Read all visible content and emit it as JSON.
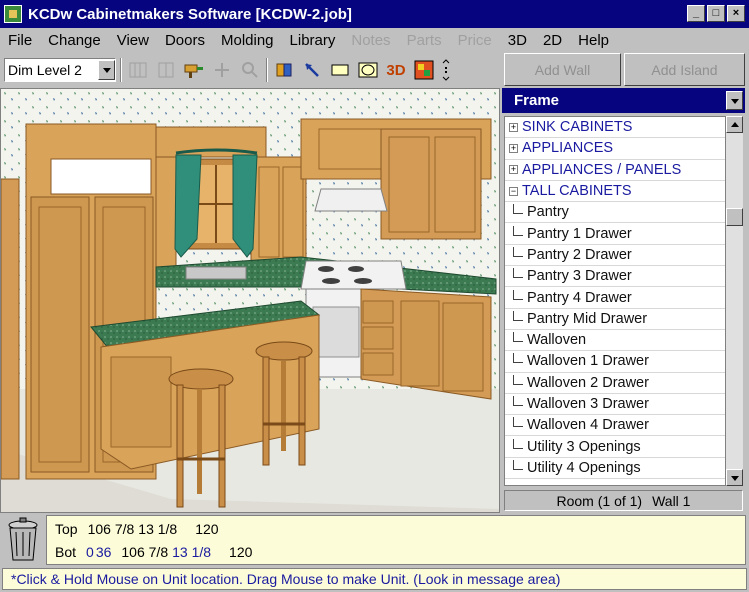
{
  "window": {
    "title": "KCDw Cabinetmakers Software [KCDW-2.job]",
    "buttons": [
      "_",
      "□",
      "×"
    ]
  },
  "menu": [
    {
      "label": "File",
      "enabled": true
    },
    {
      "label": "Change",
      "enabled": true
    },
    {
      "label": "View",
      "enabled": true
    },
    {
      "label": "Doors",
      "enabled": true
    },
    {
      "label": "Molding",
      "enabled": true
    },
    {
      "label": "Library",
      "enabled": true
    },
    {
      "label": "Notes",
      "enabled": false
    },
    {
      "label": "Parts",
      "enabled": false
    },
    {
      "label": "Price",
      "enabled": false
    },
    {
      "label": "3D",
      "enabled": true
    },
    {
      "label": "2D",
      "enabled": true
    },
    {
      "label": "Help",
      "enabled": true
    }
  ],
  "toolbar": {
    "dim_level": "Dim Level 2",
    "view3d_label": "3D",
    "add_wall": "Add Wall",
    "add_island": "Add Island"
  },
  "panel": {
    "header": "Frame",
    "items": [
      {
        "label": "SINK CABINETS",
        "kind": "cat",
        "exp": "+"
      },
      {
        "label": "APPLIANCES",
        "kind": "cat",
        "exp": "+"
      },
      {
        "label": "APPLIANCES / PANELS",
        "kind": "cat",
        "exp": "+"
      },
      {
        "label": "TALL CABINETS",
        "kind": "cat",
        "exp": "−"
      },
      {
        "label": "Pantry",
        "kind": "sub"
      },
      {
        "label": "Pantry 1 Drawer",
        "kind": "sub"
      },
      {
        "label": "Pantry 2 Drawer",
        "kind": "sub"
      },
      {
        "label": "Pantry 3 Drawer",
        "kind": "sub"
      },
      {
        "label": "Pantry 4 Drawer",
        "kind": "sub"
      },
      {
        "label": "Pantry Mid Drawer",
        "kind": "sub"
      },
      {
        "label": "Walloven",
        "kind": "sub"
      },
      {
        "label": "Walloven 1 Drawer",
        "kind": "sub"
      },
      {
        "label": "Walloven 2 Drawer",
        "kind": "sub"
      },
      {
        "label": "Walloven 3 Drawer",
        "kind": "sub"
      },
      {
        "label": "Walloven 4 Drawer",
        "kind": "sub"
      },
      {
        "label": "Utility 3 Openings",
        "kind": "sub"
      },
      {
        "label": "Utility 4 Openings",
        "kind": "sub"
      }
    ],
    "room_label": "Room (1 of 1)",
    "wall_label": "Wall 1"
  },
  "dims": {
    "top_label": "Top",
    "top_values": [
      "106 7/8",
      "13 1/8",
      "120"
    ],
    "bot_label": "Bot",
    "bot_values": [
      "0",
      "36",
      "106 7/8",
      "13 1/8",
      "120"
    ]
  },
  "message": "*Click & Hold Mouse on Unit location. Drag Mouse to make Unit. (Look in message area)",
  "colors": {
    "titlebar": "#06057f",
    "chrome": "#c0c0c0",
    "wood": "#d9a35a",
    "countertop": "#3c7a52",
    "curtain": "#2f8f7a"
  }
}
